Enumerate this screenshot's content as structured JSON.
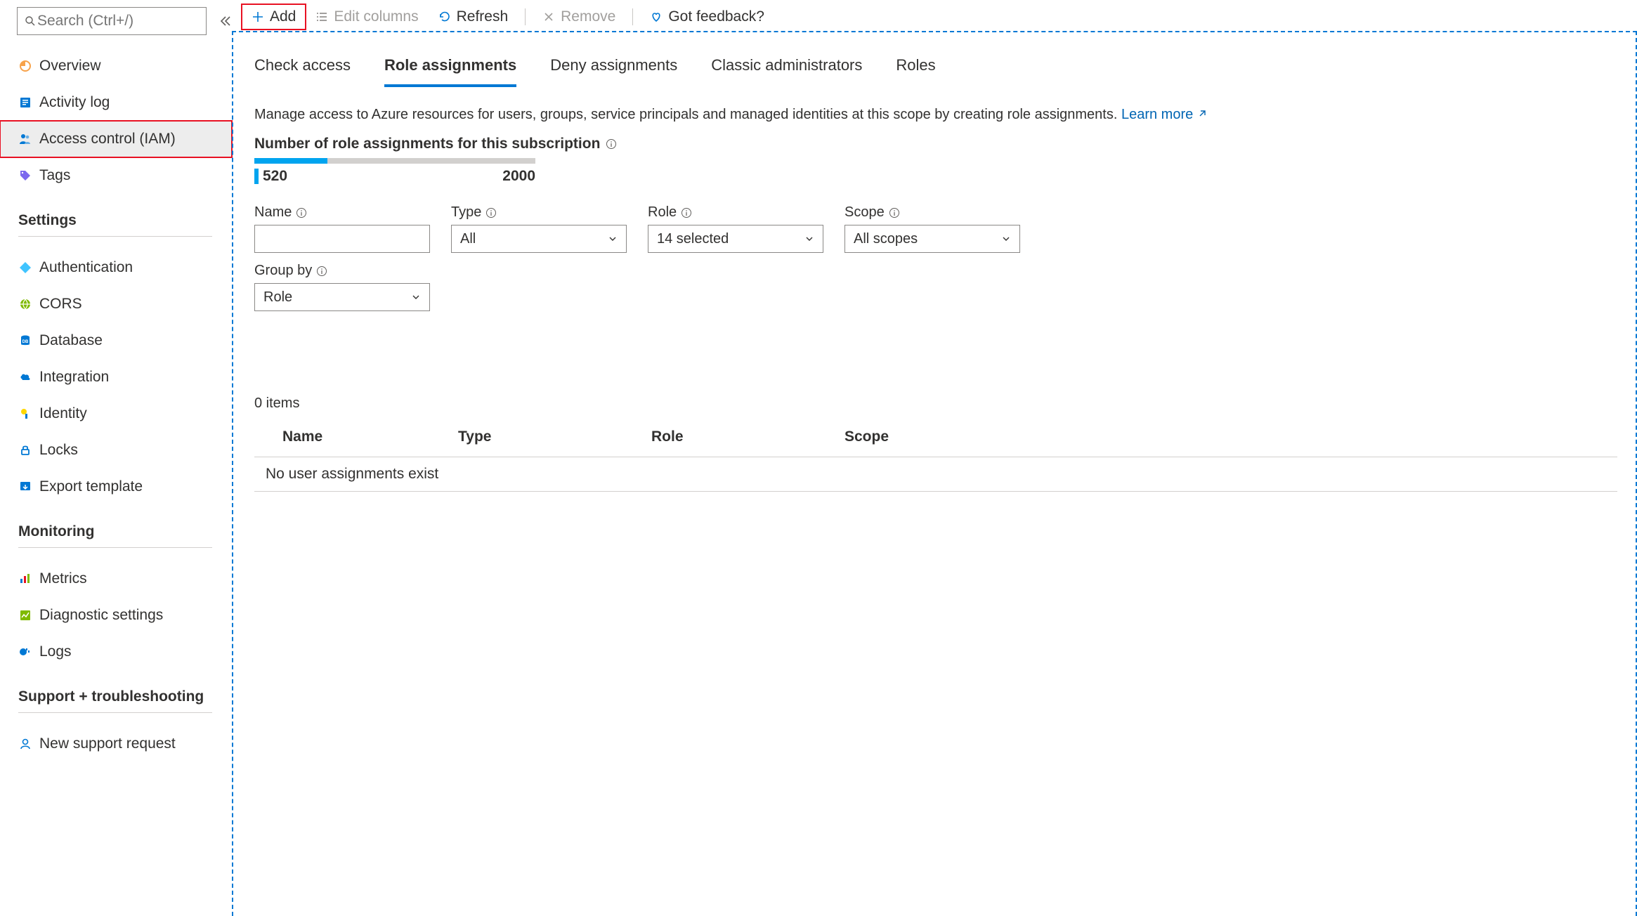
{
  "sidebar": {
    "search_placeholder": "Search (Ctrl+/)",
    "items_top": [
      {
        "label": "Overview",
        "icon": "overview"
      },
      {
        "label": "Activity log",
        "icon": "activity-log"
      },
      {
        "label": "Access control (IAM)",
        "icon": "access-control",
        "selected": true,
        "highlighted": true
      },
      {
        "label": "Tags",
        "icon": "tags"
      }
    ],
    "section_settings": "Settings",
    "items_settings": [
      {
        "label": "Authentication",
        "icon": "authentication"
      },
      {
        "label": "CORS",
        "icon": "cors"
      },
      {
        "label": "Database",
        "icon": "database"
      },
      {
        "label": "Integration",
        "icon": "integration"
      },
      {
        "label": "Identity",
        "icon": "identity"
      },
      {
        "label": "Locks",
        "icon": "locks"
      },
      {
        "label": "Export template",
        "icon": "export-template"
      }
    ],
    "section_monitoring": "Monitoring",
    "items_monitoring": [
      {
        "label": "Metrics",
        "icon": "metrics"
      },
      {
        "label": "Diagnostic settings",
        "icon": "diagnostic-settings"
      },
      {
        "label": "Logs",
        "icon": "logs"
      }
    ],
    "section_support": "Support + troubleshooting",
    "items_support": [
      {
        "label": "New support request",
        "icon": "support"
      }
    ]
  },
  "toolbar": {
    "add": "Add",
    "edit_columns": "Edit columns",
    "refresh": "Refresh",
    "remove": "Remove",
    "feedback": "Got feedback?"
  },
  "tabs": {
    "check_access": "Check access",
    "role_assignments": "Role assignments",
    "deny_assignments": "Deny assignments",
    "classic_admins": "Classic administrators",
    "roles": "Roles",
    "active": "role_assignments"
  },
  "desc_text": "Manage access to Azure resources for users, groups, service principals and managed identities at this scope by creating role assignments. ",
  "learn_more": "Learn more",
  "count_label": "Number of role assignments for this subscription",
  "count_current": "520",
  "count_max": "2000",
  "filters": {
    "name_label": "Name",
    "name_value": "",
    "type_label": "Type",
    "type_value": "All",
    "role_label": "Role",
    "role_value": "14 selected",
    "scope_label": "Scope",
    "scope_value": "All scopes",
    "groupby_label": "Group by",
    "groupby_value": "Role"
  },
  "items_count": "0 items",
  "table": {
    "col_name": "Name",
    "col_type": "Type",
    "col_role": "Role",
    "col_scope": "Scope",
    "empty": "No user assignments exist"
  },
  "chart_data": {
    "type": "bar",
    "title": "Number of role assignments for this subscription",
    "categories": [
      "Role assignments"
    ],
    "values": [
      520
    ],
    "ylim": [
      0,
      2000
    ],
    "xlabel": "",
    "ylabel": ""
  }
}
